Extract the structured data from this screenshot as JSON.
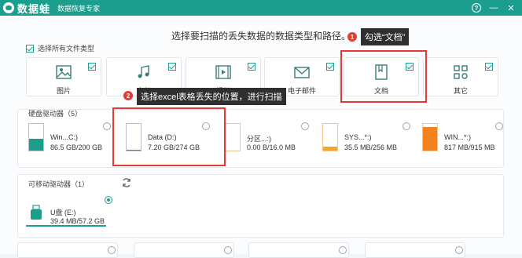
{
  "titlebar": {
    "app_name": "数据蛙",
    "subtitle": "数据恢复专家",
    "help_label": "?",
    "minimize_label": "—",
    "close_label": "✕"
  },
  "heading": "选择要扫描的丢失数据的数据类型和路径。",
  "select_all": {
    "label": "选择所有文件类型",
    "checked": true
  },
  "file_types": [
    {
      "label": "图片",
      "icon": "image-icon",
      "checked": true
    },
    {
      "label": "音频",
      "icon": "music-icon",
      "checked": true
    },
    {
      "label": "视频",
      "icon": "video-icon",
      "checked": true
    },
    {
      "label": "电子邮件",
      "icon": "email-icon",
      "checked": true
    },
    {
      "label": "文档",
      "icon": "document-icon",
      "checked": true
    },
    {
      "label": "其它",
      "icon": "other-icon",
      "checked": true
    }
  ],
  "hard_drives": {
    "title": "硬盘驱动器（5）",
    "items": [
      {
        "name": "Win...C:)",
        "size": "86.5 GB/200 GB",
        "used": 0.43,
        "color": "#1c9e8e",
        "selected": false
      },
      {
        "name": "Data (D:)",
        "size": "7.20 GB/274 GB",
        "used": 0.03,
        "color": "#1c9e8e",
        "selected": false
      },
      {
        "name": "分区...:)",
        "size": "0.00  B/16.0 MB",
        "used": 0.0,
        "color": "#f5a623",
        "selected": false
      },
      {
        "name": "SYS...*:)",
        "size": "35.5 MB/256 MB",
        "used": 0.14,
        "color": "#f5a623",
        "selected": false
      },
      {
        "name": "WIN...*:)",
        "size": "817 MB/915 MB",
        "used": 0.89,
        "color": "#f5821f",
        "selected": false
      }
    ]
  },
  "removable_drives": {
    "title": "可移动驱动器（1）",
    "refresh_icon": "refresh-icon",
    "items": [
      {
        "name": "U盘 (E:)",
        "size": "39.4 MB/57.2 GB",
        "selected": true
      }
    ]
  },
  "annotations": [
    {
      "number": "1",
      "text": "勾选“文档”"
    },
    {
      "number": "2",
      "text": "选择excel表格丢失的位置，进行扫描"
    }
  ],
  "colors": {
    "brand": "#1c9e8e",
    "highlight": "#e53935",
    "tip_bg": "#2f2f2f",
    "warning": "#f5a623"
  }
}
